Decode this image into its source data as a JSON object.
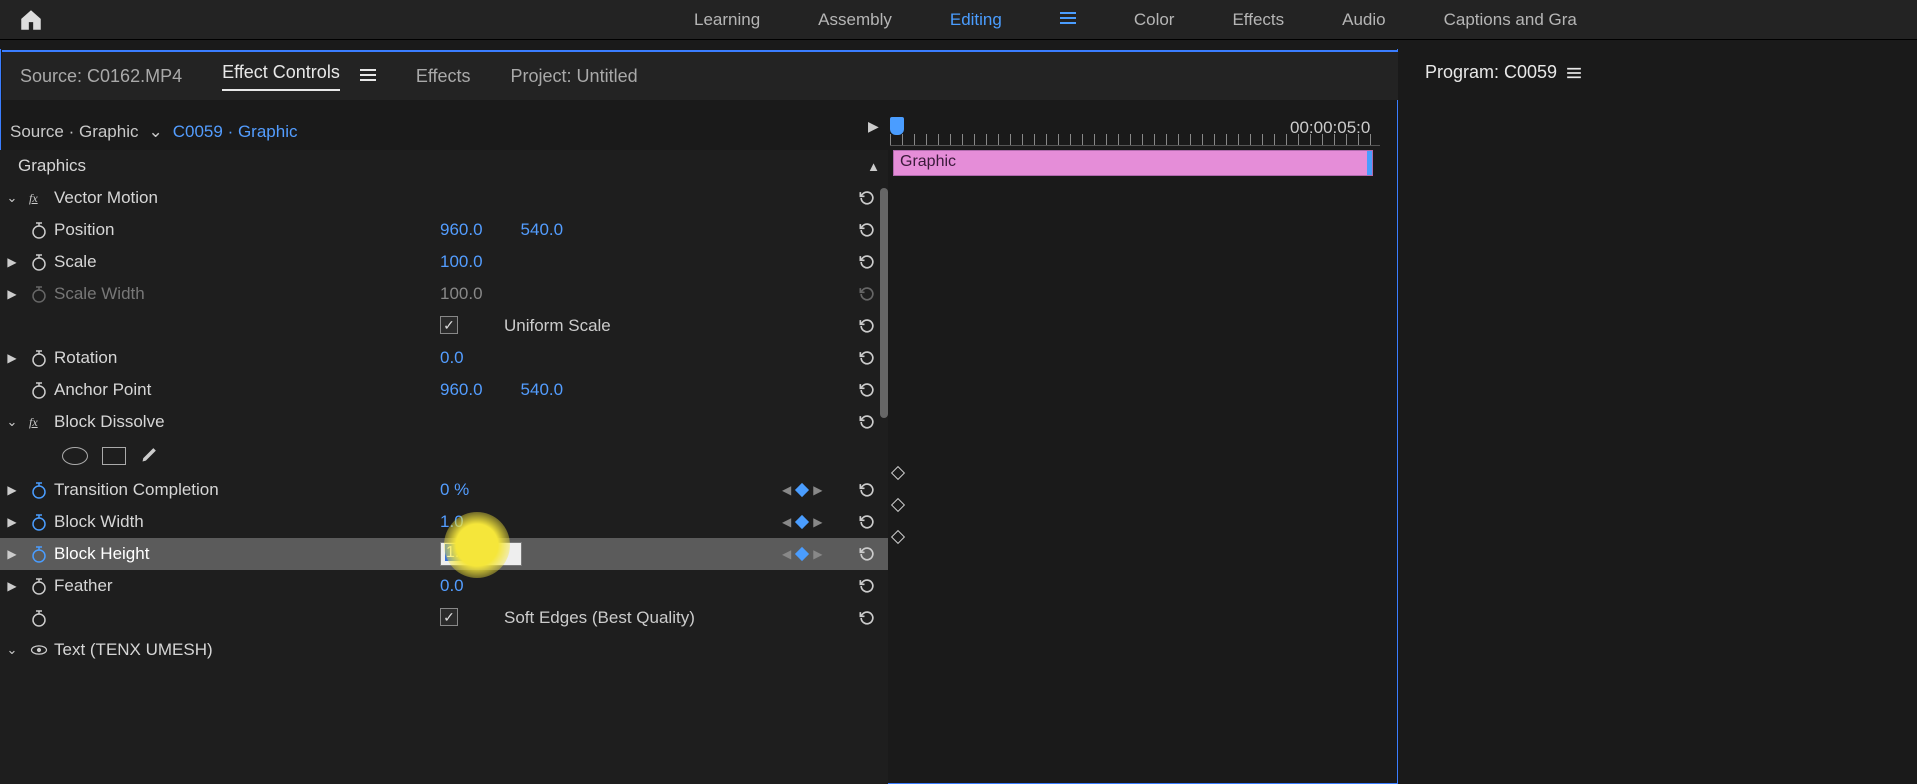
{
  "topbar": {
    "workspaces": [
      "Learning",
      "Assembly",
      "Editing",
      "Color",
      "Effects",
      "Audio",
      "Captions and Gra"
    ],
    "active_workspace": "Editing"
  },
  "panel_tabs": {
    "source": "Source: C0162.MP4",
    "effect_controls": "Effect Controls",
    "effects": "Effects",
    "project": "Project: Untitled",
    "active": "Effect Controls"
  },
  "program_panel": {
    "title": "Program: C0059"
  },
  "crumb": {
    "source": "Source · Graphic",
    "sequence": "C0059 · Graphic"
  },
  "timeline": {
    "current_time": "00:00:05:0",
    "clip_name": "Graphic"
  },
  "sections": {
    "graphics": "Graphics",
    "vector_motion": "Vector Motion",
    "block_dissolve": "Block Dissolve",
    "text": "Text (TENX UMESH)"
  },
  "props": {
    "position": {
      "label": "Position",
      "x": "960.0",
      "y": "540.0"
    },
    "scale": {
      "label": "Scale",
      "v": "100.0"
    },
    "scale_width": {
      "label": "Scale Width",
      "v": "100.0"
    },
    "uniform_scale": {
      "label": "Uniform Scale"
    },
    "rotation": {
      "label": "Rotation",
      "v": "0.0"
    },
    "anchor": {
      "label": "Anchor Point",
      "x": "960.0",
      "y": "540.0"
    },
    "transition": {
      "label": "Transition Completion",
      "v": "0 %"
    },
    "block_width": {
      "label": "Block Width",
      "v": "1.0"
    },
    "block_height": {
      "label": "Block Height",
      "v": "1.0"
    },
    "feather": {
      "label": "Feather",
      "v": "0.0"
    },
    "soft_edges": {
      "label": "Soft Edges (Best Quality)"
    }
  }
}
